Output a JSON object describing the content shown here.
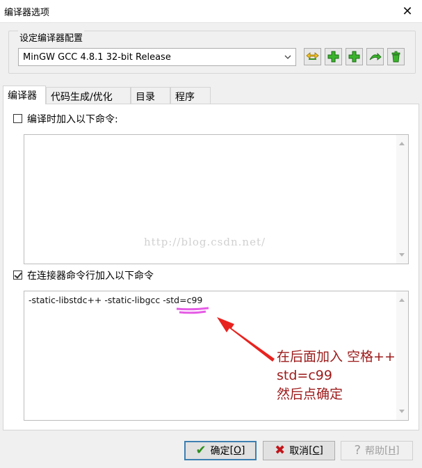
{
  "window": {
    "title": "编译器选项",
    "close_glyph": "✕"
  },
  "config": {
    "group_label": "设定编译器配置",
    "selected": "MinGW GCC 4.8.1 32-bit Release",
    "toolbar_icons": [
      "rename-icon",
      "add-icon",
      "add-copy-icon",
      "export-icon",
      "delete-icon"
    ]
  },
  "tabs": [
    {
      "label": "编译器",
      "active": true
    },
    {
      "label": "代码生成/优化",
      "active": false
    },
    {
      "label": "目录",
      "active": false
    },
    {
      "label": "程序",
      "active": false
    }
  ],
  "compiler": {
    "compile_checkbox_label": "编译时加入以下命令:",
    "compile_checked": false,
    "compile_commands": "",
    "linker_checkbox_label": "在连接器命令行加入以下命令",
    "linker_checked": true,
    "linker_commands": "-static-libstdc++ -static-libgcc -std=c99"
  },
  "watermark": "http://blog.csdn.net/",
  "annotation": {
    "line1": "在后面加入 空格++",
    "line2": "std=c99",
    "line3": "然后点确定",
    "color": "#9c1a1a",
    "arrow_color": "#e8231f",
    "highlight_color": "#e040e0"
  },
  "buttons": {
    "ok": {
      "label": "确定",
      "hotkey": "[O]",
      "icon": "check-icon"
    },
    "cancel": {
      "label": "取消",
      "hotkey": "[C]",
      "icon": "x-icon"
    },
    "help": {
      "label": "帮助",
      "hotkey": "[H]",
      "icon": "question-icon"
    }
  }
}
